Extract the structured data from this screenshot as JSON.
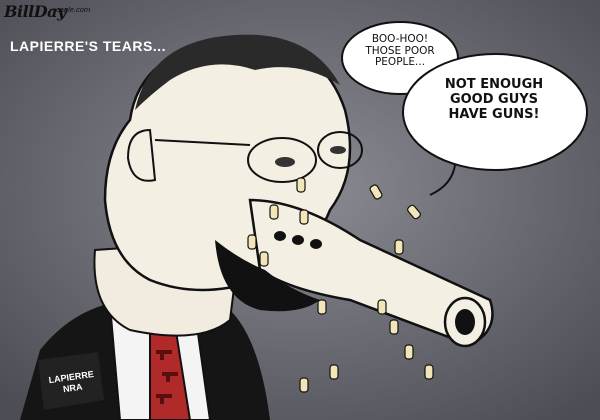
{
  "cartoon": {
    "signature": "BillDay",
    "website": "cagle.com",
    "caption": "LAPIERRE'S TEARS...",
    "bubble_small": [
      "BOO-HOO!",
      "THOSE POOR",
      "PEOPLE..."
    ],
    "bubble_large": [
      "NOT ENOUGH",
      "GOOD GUYS",
      "HAVE GUNS!"
    ],
    "lapel_tag": [
      "LAPIERRE",
      "NRA"
    ]
  }
}
